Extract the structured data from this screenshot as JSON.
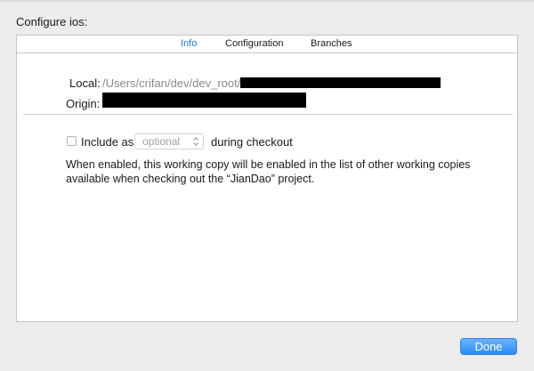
{
  "sheet": {
    "title": "Configure ios:"
  },
  "tabs": [
    {
      "label": "Info",
      "selected": true
    },
    {
      "label": "Configuration",
      "selected": false
    },
    {
      "label": "Branches",
      "selected": false
    }
  ],
  "info": {
    "local_label": "Local:",
    "local_value": "/Users/crifan/dev/dev_root/c",
    "origin_label": "Origin:"
  },
  "checkout": {
    "checked": false,
    "include_label": "Include as",
    "select_value": "optional",
    "during_label": "during checkout",
    "description": "When enabled, this working copy will be enabled in the list of other working copies available when checking out the “JianDao” project."
  },
  "footer": {
    "done_label": "Done"
  },
  "colors": {
    "accent": "#1b7ce0",
    "button": "#2a8cf6"
  }
}
